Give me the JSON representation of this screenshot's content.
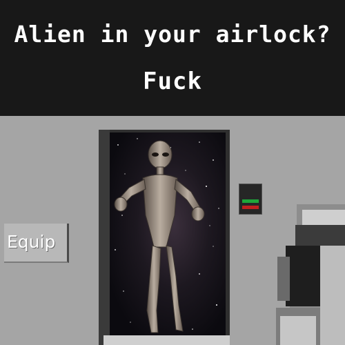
{
  "caption": {
    "line1": "Alien in your airlock?",
    "line2": "Fuck"
  },
  "hud": {
    "equip_label": "Equip"
  },
  "keypad": {
    "status_green": "#1ea63a",
    "status_red": "#c02020"
  },
  "icons": {
    "alien": "alien-figure-icon",
    "weapon": "held-weapon-icon",
    "stars": "starfield-icon"
  }
}
